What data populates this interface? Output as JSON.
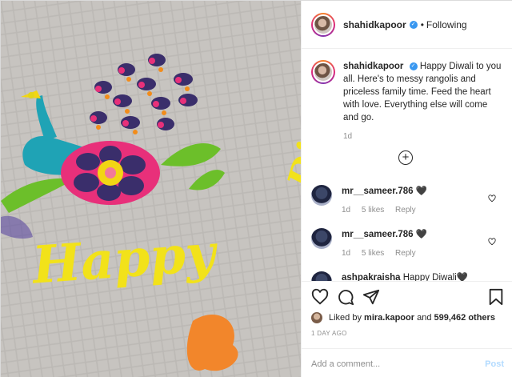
{
  "post": {
    "username": "shahidkapoor",
    "follow_status": "Following",
    "separator": "•"
  },
  "caption": {
    "username": "shahidkapoor",
    "text": "Happy Diwali to you all. Here's to messy rangolis and priceless family time. Feed the heart with love. Everything else will come and go.",
    "age": "1d"
  },
  "comments": [
    {
      "username": "mr__sameer.786",
      "text": "🖤",
      "age": "1d",
      "likes": "5 likes",
      "reply": "Reply"
    },
    {
      "username": "mr__sameer.786",
      "text": "🖤",
      "age": "1d",
      "likes": "5 likes",
      "reply": "Reply"
    },
    {
      "username": "ashpakraisha",
      "text": "Happy Diwali🖤"
    }
  ],
  "likes": {
    "prefix": "Liked by",
    "user": "mira.kapoor",
    "connector": "and",
    "others": "599,462 others"
  },
  "date": "1 DAY AGO",
  "add_comment": {
    "placeholder": "Add a comment...",
    "post_label": "Post"
  },
  "photo": {
    "words": [
      "Happy",
      "Diwali"
    ]
  },
  "icons": [
    "verified-badge-icon",
    "heart-icon",
    "comment-icon",
    "share-icon",
    "bookmark-icon",
    "plus-circle-icon"
  ],
  "colors": {
    "verified": "#3897f0",
    "post_disabled": "#b3dbff",
    "muted": "#8e8e8e"
  }
}
